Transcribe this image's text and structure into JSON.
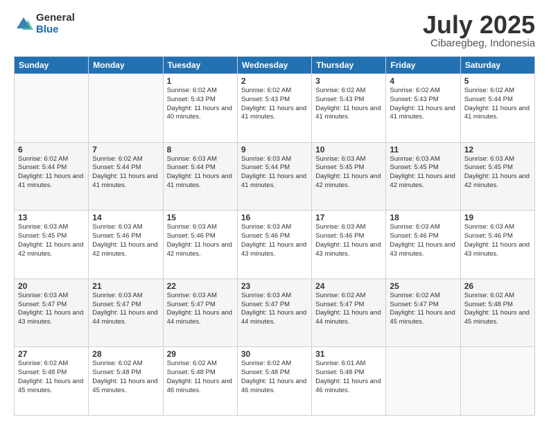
{
  "logo": {
    "general": "General",
    "blue": "Blue"
  },
  "title": "July 2025",
  "location": "Cibaregbeg, Indonesia",
  "headers": [
    "Sunday",
    "Monday",
    "Tuesday",
    "Wednesday",
    "Thursday",
    "Friday",
    "Saturday"
  ],
  "weeks": [
    [
      {
        "day": "",
        "info": ""
      },
      {
        "day": "",
        "info": ""
      },
      {
        "day": "1",
        "info": "Sunrise: 6:02 AM\nSunset: 5:43 PM\nDaylight: 11 hours and 40 minutes."
      },
      {
        "day": "2",
        "info": "Sunrise: 6:02 AM\nSunset: 5:43 PM\nDaylight: 11 hours and 41 minutes."
      },
      {
        "day": "3",
        "info": "Sunrise: 6:02 AM\nSunset: 5:43 PM\nDaylight: 11 hours and 41 minutes."
      },
      {
        "day": "4",
        "info": "Sunrise: 6:02 AM\nSunset: 5:43 PM\nDaylight: 11 hours and 41 minutes."
      },
      {
        "day": "5",
        "info": "Sunrise: 6:02 AM\nSunset: 5:44 PM\nDaylight: 11 hours and 41 minutes."
      }
    ],
    [
      {
        "day": "6",
        "info": "Sunrise: 6:02 AM\nSunset: 5:44 PM\nDaylight: 11 hours and 41 minutes."
      },
      {
        "day": "7",
        "info": "Sunrise: 6:02 AM\nSunset: 5:44 PM\nDaylight: 11 hours and 41 minutes."
      },
      {
        "day": "8",
        "info": "Sunrise: 6:03 AM\nSunset: 5:44 PM\nDaylight: 11 hours and 41 minutes."
      },
      {
        "day": "9",
        "info": "Sunrise: 6:03 AM\nSunset: 5:44 PM\nDaylight: 11 hours and 41 minutes."
      },
      {
        "day": "10",
        "info": "Sunrise: 6:03 AM\nSunset: 5:45 PM\nDaylight: 11 hours and 42 minutes."
      },
      {
        "day": "11",
        "info": "Sunrise: 6:03 AM\nSunset: 5:45 PM\nDaylight: 11 hours and 42 minutes."
      },
      {
        "day": "12",
        "info": "Sunrise: 6:03 AM\nSunset: 5:45 PM\nDaylight: 11 hours and 42 minutes."
      }
    ],
    [
      {
        "day": "13",
        "info": "Sunrise: 6:03 AM\nSunset: 5:45 PM\nDaylight: 11 hours and 42 minutes."
      },
      {
        "day": "14",
        "info": "Sunrise: 6:03 AM\nSunset: 5:46 PM\nDaylight: 11 hours and 42 minutes."
      },
      {
        "day": "15",
        "info": "Sunrise: 6:03 AM\nSunset: 5:46 PM\nDaylight: 11 hours and 42 minutes."
      },
      {
        "day": "16",
        "info": "Sunrise: 6:03 AM\nSunset: 5:46 PM\nDaylight: 11 hours and 43 minutes."
      },
      {
        "day": "17",
        "info": "Sunrise: 6:03 AM\nSunset: 5:46 PM\nDaylight: 11 hours and 43 minutes."
      },
      {
        "day": "18",
        "info": "Sunrise: 6:03 AM\nSunset: 5:46 PM\nDaylight: 11 hours and 43 minutes."
      },
      {
        "day": "19",
        "info": "Sunrise: 6:03 AM\nSunset: 5:46 PM\nDaylight: 11 hours and 43 minutes."
      }
    ],
    [
      {
        "day": "20",
        "info": "Sunrise: 6:03 AM\nSunset: 5:47 PM\nDaylight: 11 hours and 43 minutes."
      },
      {
        "day": "21",
        "info": "Sunrise: 6:03 AM\nSunset: 5:47 PM\nDaylight: 11 hours and 44 minutes."
      },
      {
        "day": "22",
        "info": "Sunrise: 6:03 AM\nSunset: 5:47 PM\nDaylight: 11 hours and 44 minutes."
      },
      {
        "day": "23",
        "info": "Sunrise: 6:03 AM\nSunset: 5:47 PM\nDaylight: 11 hours and 44 minutes."
      },
      {
        "day": "24",
        "info": "Sunrise: 6:02 AM\nSunset: 5:47 PM\nDaylight: 11 hours and 44 minutes."
      },
      {
        "day": "25",
        "info": "Sunrise: 6:02 AM\nSunset: 5:47 PM\nDaylight: 11 hours and 45 minutes."
      },
      {
        "day": "26",
        "info": "Sunrise: 6:02 AM\nSunset: 5:48 PM\nDaylight: 11 hours and 45 minutes."
      }
    ],
    [
      {
        "day": "27",
        "info": "Sunrise: 6:02 AM\nSunset: 5:48 PM\nDaylight: 11 hours and 45 minutes."
      },
      {
        "day": "28",
        "info": "Sunrise: 6:02 AM\nSunset: 5:48 PM\nDaylight: 11 hours and 45 minutes."
      },
      {
        "day": "29",
        "info": "Sunrise: 6:02 AM\nSunset: 5:48 PM\nDaylight: 11 hours and 46 minutes."
      },
      {
        "day": "30",
        "info": "Sunrise: 6:02 AM\nSunset: 5:48 PM\nDaylight: 11 hours and 46 minutes."
      },
      {
        "day": "31",
        "info": "Sunrise: 6:01 AM\nSunset: 5:48 PM\nDaylight: 11 hours and 46 minutes."
      },
      {
        "day": "",
        "info": ""
      },
      {
        "day": "",
        "info": ""
      }
    ]
  ]
}
